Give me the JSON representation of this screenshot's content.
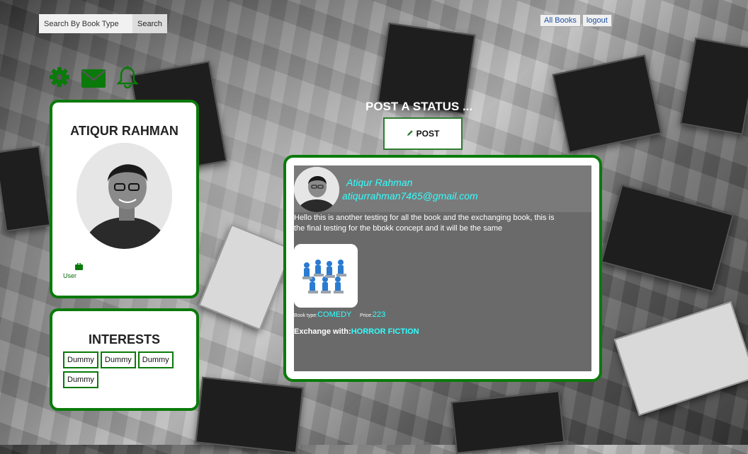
{
  "search": {
    "placeholder": "Search By Book Type",
    "button_label": "Search"
  },
  "nav": {
    "all_books": "All Books",
    "logout": "logout"
  },
  "icons": {
    "settings": "gear-icon",
    "mail": "envelope-icon",
    "notifications": "bell-icon",
    "color": "#0a7a0a"
  },
  "profile": {
    "name": "ATIQUR RAHMAN",
    "role": "User"
  },
  "interests": {
    "title": "INTERESTS",
    "items": [
      "Dummy",
      "Dummy",
      "Dummy",
      "Dummy"
    ]
  },
  "composer": {
    "title": "POST A STATUS ...",
    "button_label": "POST"
  },
  "post": {
    "user_name": "Atiqur Rahman",
    "email": "atiqurrahman7465@gmail.com",
    "text": "Hello this is another testing for all the book and the exchanging book, this is the final testing for the bbokk concept and it will be the same",
    "book_type_label": "Book type:",
    "book_type": "COMEDY",
    "price_label": "Price:",
    "price": "223",
    "exchange_label": "Exchange with:",
    "exchange_value": "HORROR FICTION"
  },
  "colors": {
    "accent": "#0a7a0a",
    "link_cyan": "#33ffff"
  }
}
